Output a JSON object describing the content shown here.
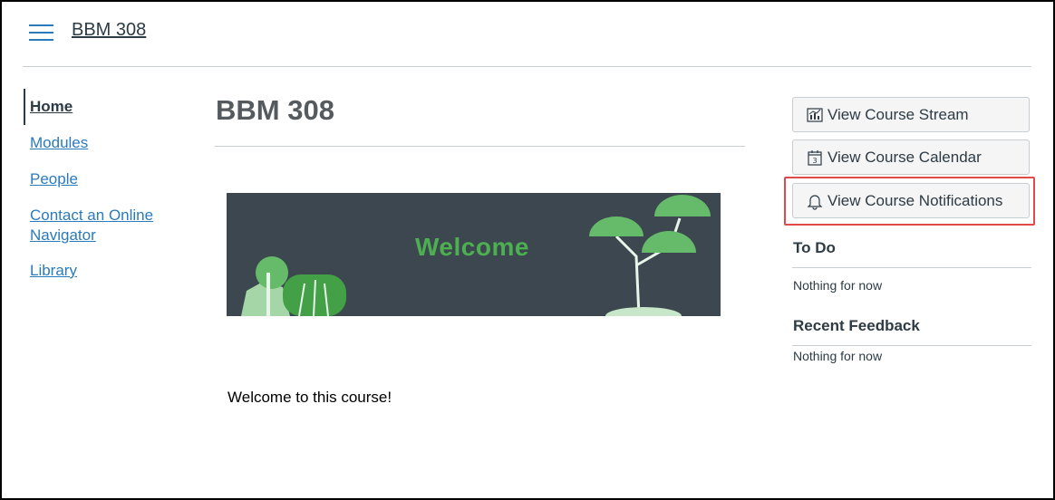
{
  "header": {
    "course_title": "BBM 308",
    "menu_icon": "hamburger-icon"
  },
  "course_nav": {
    "items": [
      {
        "label": "Home",
        "active": true
      },
      {
        "label": "Modules"
      },
      {
        "label": "People"
      },
      {
        "label": "Contact an Online Navigator"
      },
      {
        "label": "Library"
      }
    ]
  },
  "main": {
    "title": "BBM 308",
    "banner_text": "Welcome",
    "body_text": "Welcome to this course!"
  },
  "sidebar": {
    "buttons": [
      {
        "label": "View Course Stream",
        "icon": "stream-chart-icon"
      },
      {
        "label": "View Course Calendar",
        "icon": "calendar-icon"
      },
      {
        "label": "View Course Notifications",
        "icon": "bell-icon"
      }
    ],
    "todo": {
      "heading": "To Do",
      "empty": "Nothing for now"
    },
    "feedback": {
      "heading": "Recent Feedback",
      "empty": "Nothing for now"
    }
  },
  "colors": {
    "link": "#2b7abc",
    "banner_bg": "#3d4750",
    "banner_text": "#4caf50",
    "highlight": "#e04a4a"
  }
}
